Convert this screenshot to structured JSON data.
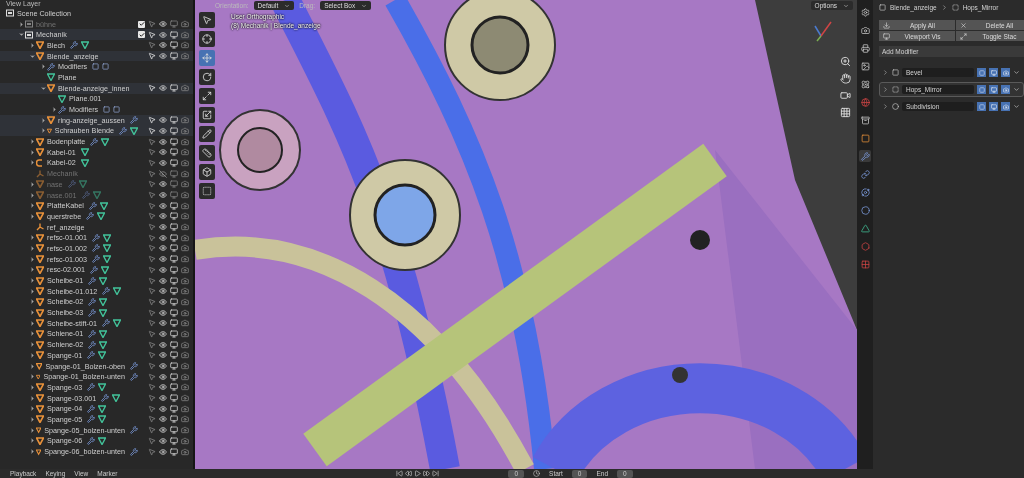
{
  "outliner": {
    "header": "View Layer",
    "root": "Scene Collection",
    "items": [
      {
        "name": "bühne",
        "kind": "collection",
        "expanded": false,
        "disabled": true,
        "checked": true,
        "selected": false,
        "visible": true
      },
      {
        "name": "Mechanik",
        "kind": "collection",
        "expanded": true,
        "disabled": false,
        "checked": true,
        "selected": true,
        "visible": true,
        "children": [
          {
            "name": "Blech",
            "kind": "mesh",
            "expanded": false,
            "disabled": false,
            "selected": false,
            "visible": true,
            "modifiers": true,
            "mesh_data": true
          },
          {
            "name": "Blende_anzeige",
            "kind": "mesh",
            "expanded": true,
            "disabled": false,
            "selected": true,
            "visible": true,
            "children": [
              {
                "name": "Modifiers",
                "kind": "modifiers",
                "expanded": false
              },
              {
                "name": "Plane",
                "kind": "meshdata"
              },
              {
                "name": "Blende-anzeige_innen",
                "kind": "mesh",
                "expanded": true,
                "disabled": false,
                "selected": true,
                "visible": true,
                "children": [
                  {
                    "name": "Plane.001",
                    "kind": "meshdata"
                  },
                  {
                    "name": "Modifiers",
                    "kind": "modifiers",
                    "expanded": false
                  }
                ]
              },
              {
                "name": "ring-anzeige_aussen",
                "kind": "mesh",
                "expanded": false,
                "disabled": false,
                "selected": true,
                "visible": true,
                "modifiers": true,
                "mesh_data": false
              },
              {
                "name": "Schrauben Blende",
                "kind": "mesh",
                "expanded": false,
                "disabled": false,
                "selected": true,
                "visible": true,
                "modifiers": true,
                "mesh_data": true
              }
            ]
          },
          {
            "name": "Bodenplatte",
            "kind": "mesh",
            "expanded": false,
            "disabled": false,
            "selected": false,
            "visible": true,
            "modifiers": true,
            "mesh_data": true
          },
          {
            "name": "Kabel-01",
            "kind": "mesh",
            "expanded": false,
            "disabled": false,
            "selected": false,
            "visible": true,
            "modifiers": false,
            "mesh_data": true
          },
          {
            "name": "Kabel-02",
            "kind": "curve",
            "expanded": false,
            "disabled": false,
            "selected": false,
            "visible": true,
            "modifiers": false,
            "mesh_data": true
          },
          {
            "name": "Mechanik",
            "kind": "empty",
            "disabled": true,
            "selected": false,
            "visible": false
          },
          {
            "name": "nase",
            "kind": "mesh",
            "expanded": false,
            "disabled": true,
            "selected": false,
            "visible": true,
            "modifiers": true,
            "mesh_data": true
          },
          {
            "name": "nase.001",
            "kind": "mesh",
            "expanded": false,
            "disabled": true,
            "selected": false,
            "visible": true,
            "modifiers": true,
            "mesh_data": true
          },
          {
            "name": "PlatteKabel",
            "kind": "mesh",
            "expanded": false,
            "disabled": false,
            "selected": false,
            "visible": true,
            "modifiers": true,
            "mesh_data": true
          },
          {
            "name": "querstrebe",
            "kind": "mesh",
            "expanded": false,
            "disabled": false,
            "selected": false,
            "visible": true,
            "modifiers": true,
            "mesh_data": true
          },
          {
            "name": "ref_anzeige",
            "kind": "empty",
            "disabled": false,
            "selected": false,
            "visible": true
          },
          {
            "name": "refsc-01.001",
            "kind": "mesh",
            "expanded": false,
            "disabled": false,
            "selected": false,
            "visible": true,
            "modifiers": true,
            "mesh_data": true
          },
          {
            "name": "refsc-01.002",
            "kind": "mesh",
            "expanded": false,
            "disabled": false,
            "selected": false,
            "visible": true,
            "modifiers": true,
            "mesh_data": true
          },
          {
            "name": "refsc-01.003",
            "kind": "mesh",
            "expanded": false,
            "disabled": false,
            "selected": false,
            "visible": true,
            "modifiers": true,
            "mesh_data": true
          },
          {
            "name": "resc-02.001",
            "kind": "mesh",
            "expanded": false,
            "disabled": false,
            "selected": false,
            "visible": true,
            "modifiers": true,
            "mesh_data": true
          },
          {
            "name": "Scheibe-01",
            "kind": "mesh",
            "expanded": false,
            "disabled": false,
            "selected": false,
            "visible": true,
            "modifiers": true,
            "mesh_data": true
          },
          {
            "name": "Scheibe-01.012",
            "kind": "mesh",
            "expanded": false,
            "disabled": false,
            "selected": false,
            "visible": true,
            "modifiers": true,
            "mesh_data": true
          },
          {
            "name": "Scheibe-02",
            "kind": "mesh",
            "expanded": false,
            "disabled": false,
            "selected": false,
            "visible": true,
            "modifiers": true,
            "mesh_data": true
          },
          {
            "name": "Scheibe-03",
            "kind": "mesh",
            "expanded": false,
            "disabled": false,
            "selected": false,
            "visible": true,
            "modifiers": true,
            "mesh_data": true
          },
          {
            "name": "Scheibe-stift-01",
            "kind": "mesh",
            "expanded": false,
            "disabled": false,
            "selected": false,
            "visible": true,
            "modifiers": true,
            "mesh_data": true
          },
          {
            "name": "Schiene-01",
            "kind": "mesh",
            "expanded": false,
            "disabled": false,
            "selected": false,
            "visible": true,
            "modifiers": true,
            "mesh_data": true
          },
          {
            "name": "Schiene-02",
            "kind": "mesh",
            "expanded": false,
            "disabled": false,
            "selected": false,
            "visible": true,
            "modifiers": true,
            "mesh_data": true
          },
          {
            "name": "Spange-01",
            "kind": "mesh",
            "expanded": false,
            "disabled": false,
            "selected": false,
            "visible": true,
            "modifiers": true,
            "mesh_data": true
          },
          {
            "name": "Spange-01_Bolzen-oben",
            "kind": "mesh",
            "expanded": false,
            "disabled": false,
            "selected": false,
            "visible": true,
            "modifiers": true,
            "mesh_data": false
          },
          {
            "name": "Spange-01_Bolzen-unten",
            "kind": "mesh",
            "expanded": false,
            "disabled": false,
            "selected": false,
            "visible": true,
            "modifiers": true,
            "mesh_data": false
          },
          {
            "name": "Spange-03",
            "kind": "mesh",
            "expanded": false,
            "disabled": false,
            "selected": false,
            "visible": true,
            "modifiers": true,
            "mesh_data": true
          },
          {
            "name": "Spange-03.001",
            "kind": "mesh",
            "expanded": false,
            "disabled": false,
            "selected": false,
            "visible": true,
            "modifiers": true,
            "mesh_data": true
          },
          {
            "name": "Spange-04",
            "kind": "mesh",
            "expanded": false,
            "disabled": false,
            "selected": false,
            "visible": true,
            "modifiers": true,
            "mesh_data": true
          },
          {
            "name": "Spange-05",
            "kind": "mesh",
            "expanded": false,
            "disabled": false,
            "selected": false,
            "visible": true,
            "modifiers": true,
            "mesh_data": true
          },
          {
            "name": "Spange-05_bolzen-unten",
            "kind": "mesh",
            "expanded": false,
            "disabled": false,
            "selected": false,
            "visible": true,
            "modifiers": true,
            "mesh_data": false
          },
          {
            "name": "Spange-06",
            "kind": "mesh",
            "expanded": false,
            "disabled": false,
            "selected": false,
            "visible": true,
            "modifiers": true,
            "mesh_data": true
          },
          {
            "name": "Spange-06_bolzen-unten",
            "kind": "mesh",
            "expanded": false,
            "disabled": false,
            "selected": false,
            "visible": true,
            "modifiers": true,
            "mesh_data": false
          }
        ]
      }
    ]
  },
  "viewport": {
    "header": {
      "orientation_label": "Orientation:",
      "orientation": "Default",
      "drag_label": "Drag:",
      "drag": "Select Box",
      "options": "Options"
    },
    "view_name": "User Orthographic",
    "context": "(8) Mechanik | Blende_anzeige",
    "tools": [
      {
        "kind": "select",
        "selected": false
      },
      {
        "kind": "cursor",
        "selected": false
      },
      {
        "kind": "move",
        "selected": true
      },
      {
        "kind": "rotate",
        "selected": false
      },
      {
        "kind": "scale",
        "selected": false
      },
      {
        "kind": "transform",
        "selected": false
      },
      {
        "kind": "annotate",
        "selected": false
      },
      {
        "kind": "measure",
        "selected": false
      },
      {
        "kind": "cube",
        "selected": false
      },
      {
        "kind": "extrude",
        "selected": false
      }
    ]
  },
  "properties": {
    "tabs": [
      {
        "kind": "tool",
        "selected": false
      },
      {
        "kind": "render",
        "selected": false
      },
      {
        "kind": "output",
        "selected": false
      },
      {
        "kind": "view-layer",
        "selected": false
      },
      {
        "kind": "scene",
        "selected": false
      },
      {
        "kind": "world",
        "selected": false
      },
      {
        "kind": "collection",
        "selected": false
      },
      {
        "kind": "object",
        "selected": false
      },
      {
        "kind": "modifier",
        "selected": true
      },
      {
        "kind": "particles",
        "selected": false
      },
      {
        "kind": "physics",
        "selected": false
      },
      {
        "kind": "constraints",
        "selected": false
      },
      {
        "kind": "data",
        "selected": false
      },
      {
        "kind": "material",
        "selected": false
      },
      {
        "kind": "texture",
        "selected": false
      }
    ],
    "breadcrumb": [
      "Blende_anzeige",
      "Hops_Mirror"
    ],
    "buttons": [
      {
        "kind": "apply",
        "label": "Apply All"
      },
      {
        "kind": "delete",
        "label": "Delete All"
      },
      {
        "kind": "viewport",
        "label": "Viewport Vis"
      },
      {
        "kind": "toggle",
        "label": "Toggle Stac"
      }
    ],
    "add_modifier": "Add Modifier",
    "modifiers": [
      {
        "name": "Bevel",
        "kind": "bevel",
        "selected": false
      },
      {
        "name": "Hops_Mirror",
        "kind": "mirror",
        "selected": true
      },
      {
        "name": "Subdivision",
        "kind": "subdivision",
        "selected": false
      }
    ]
  },
  "timeline": {
    "menus": [
      "Playback",
      "Keying",
      "View",
      "Marker"
    ],
    "frame": "0",
    "start_label": "Start",
    "start": "0",
    "end_label": "End",
    "end": "0"
  }
}
